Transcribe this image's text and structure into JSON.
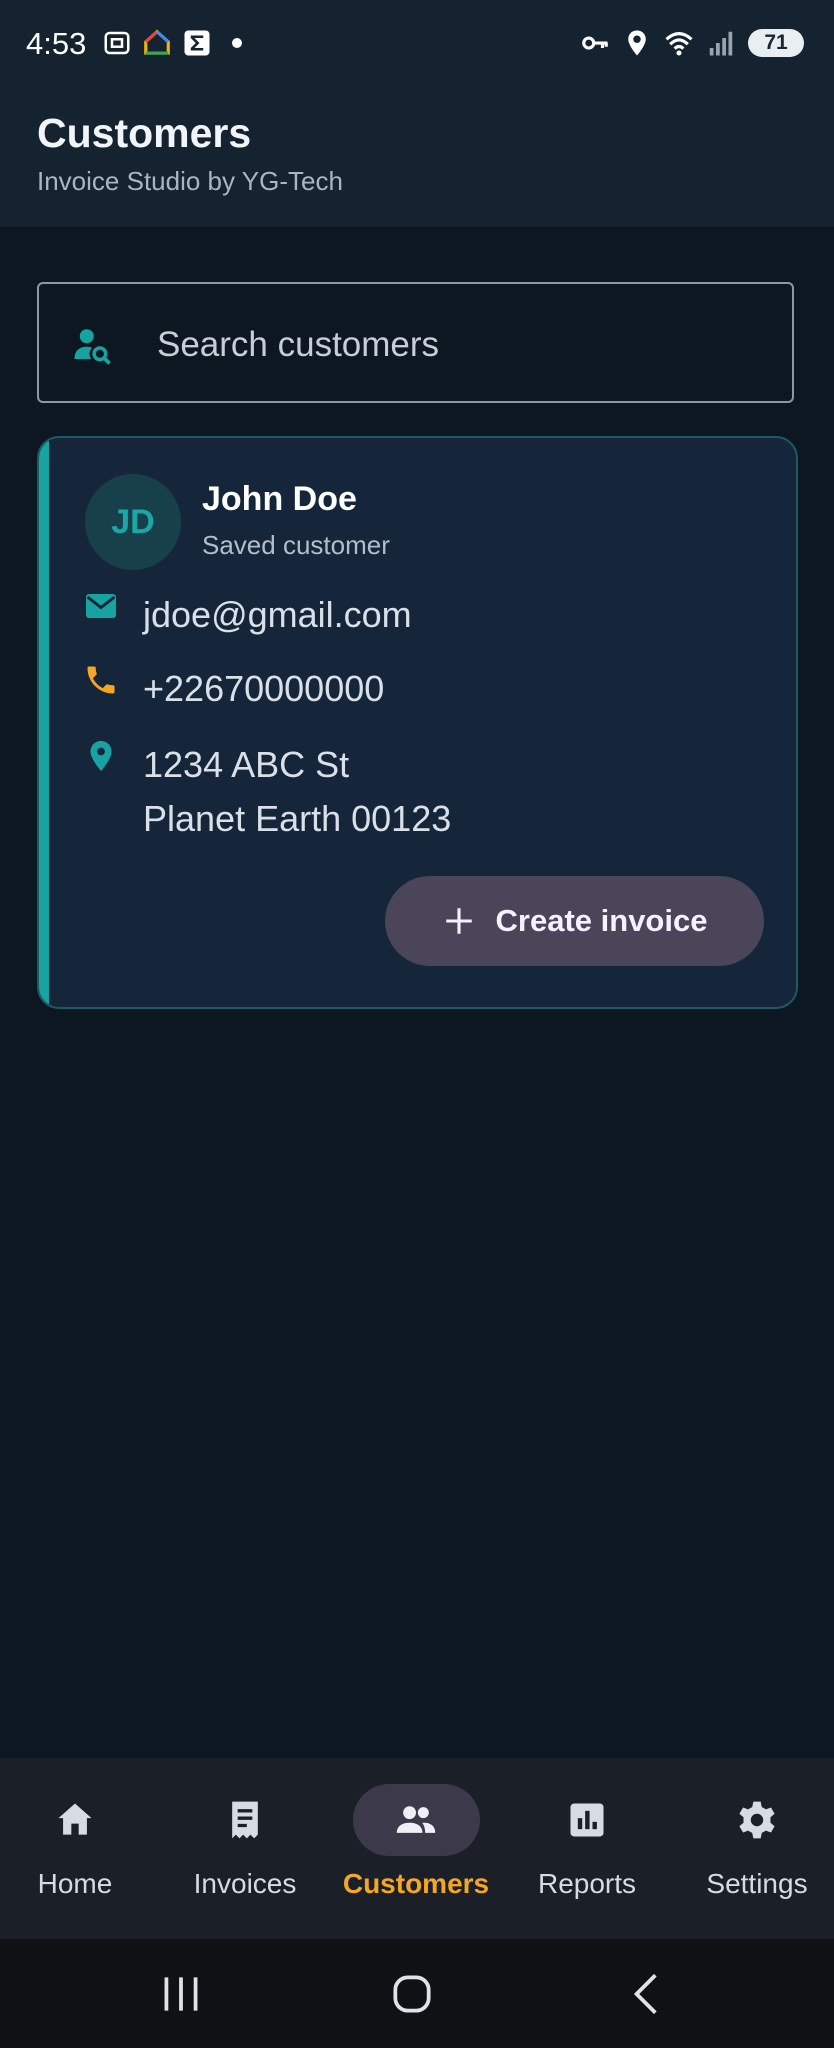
{
  "status": {
    "time": "4:53",
    "battery": "71",
    "left_icons": [
      "screenshot-icon",
      "home-app-icon",
      "sigma-icon",
      "dot-icon"
    ],
    "right_icons": [
      "key-icon",
      "location-icon",
      "wifi-icon",
      "signal-icon"
    ]
  },
  "appbar": {
    "title": "Customers",
    "subtitle": "Invoice Studio by YG-Tech"
  },
  "search": {
    "placeholder": "Search customers",
    "value": ""
  },
  "customer": {
    "initials": "JD",
    "name": "John Doe",
    "status": "Saved customer",
    "email": "jdoe@gmail.com",
    "phone": "+22670000000",
    "address_line1": "1234 ABC St",
    "address_line2": "Planet Earth 00123",
    "create_label": "Create invoice"
  },
  "nav": {
    "items": [
      {
        "label": "Home",
        "icon": "home-icon",
        "active": false
      },
      {
        "label": "Invoices",
        "icon": "receipt-icon",
        "active": false
      },
      {
        "label": "Customers",
        "icon": "people-icon",
        "active": true
      },
      {
        "label": "Reports",
        "icon": "bar-chart-icon",
        "active": false
      },
      {
        "label": "Settings",
        "icon": "gear-icon",
        "active": false
      }
    ]
  },
  "colors": {
    "accent_teal": "#18a3a3",
    "active_nav": "#f5a623",
    "phone_icon": "#f5a623",
    "background": "#0d1722",
    "card": "#15263a"
  }
}
